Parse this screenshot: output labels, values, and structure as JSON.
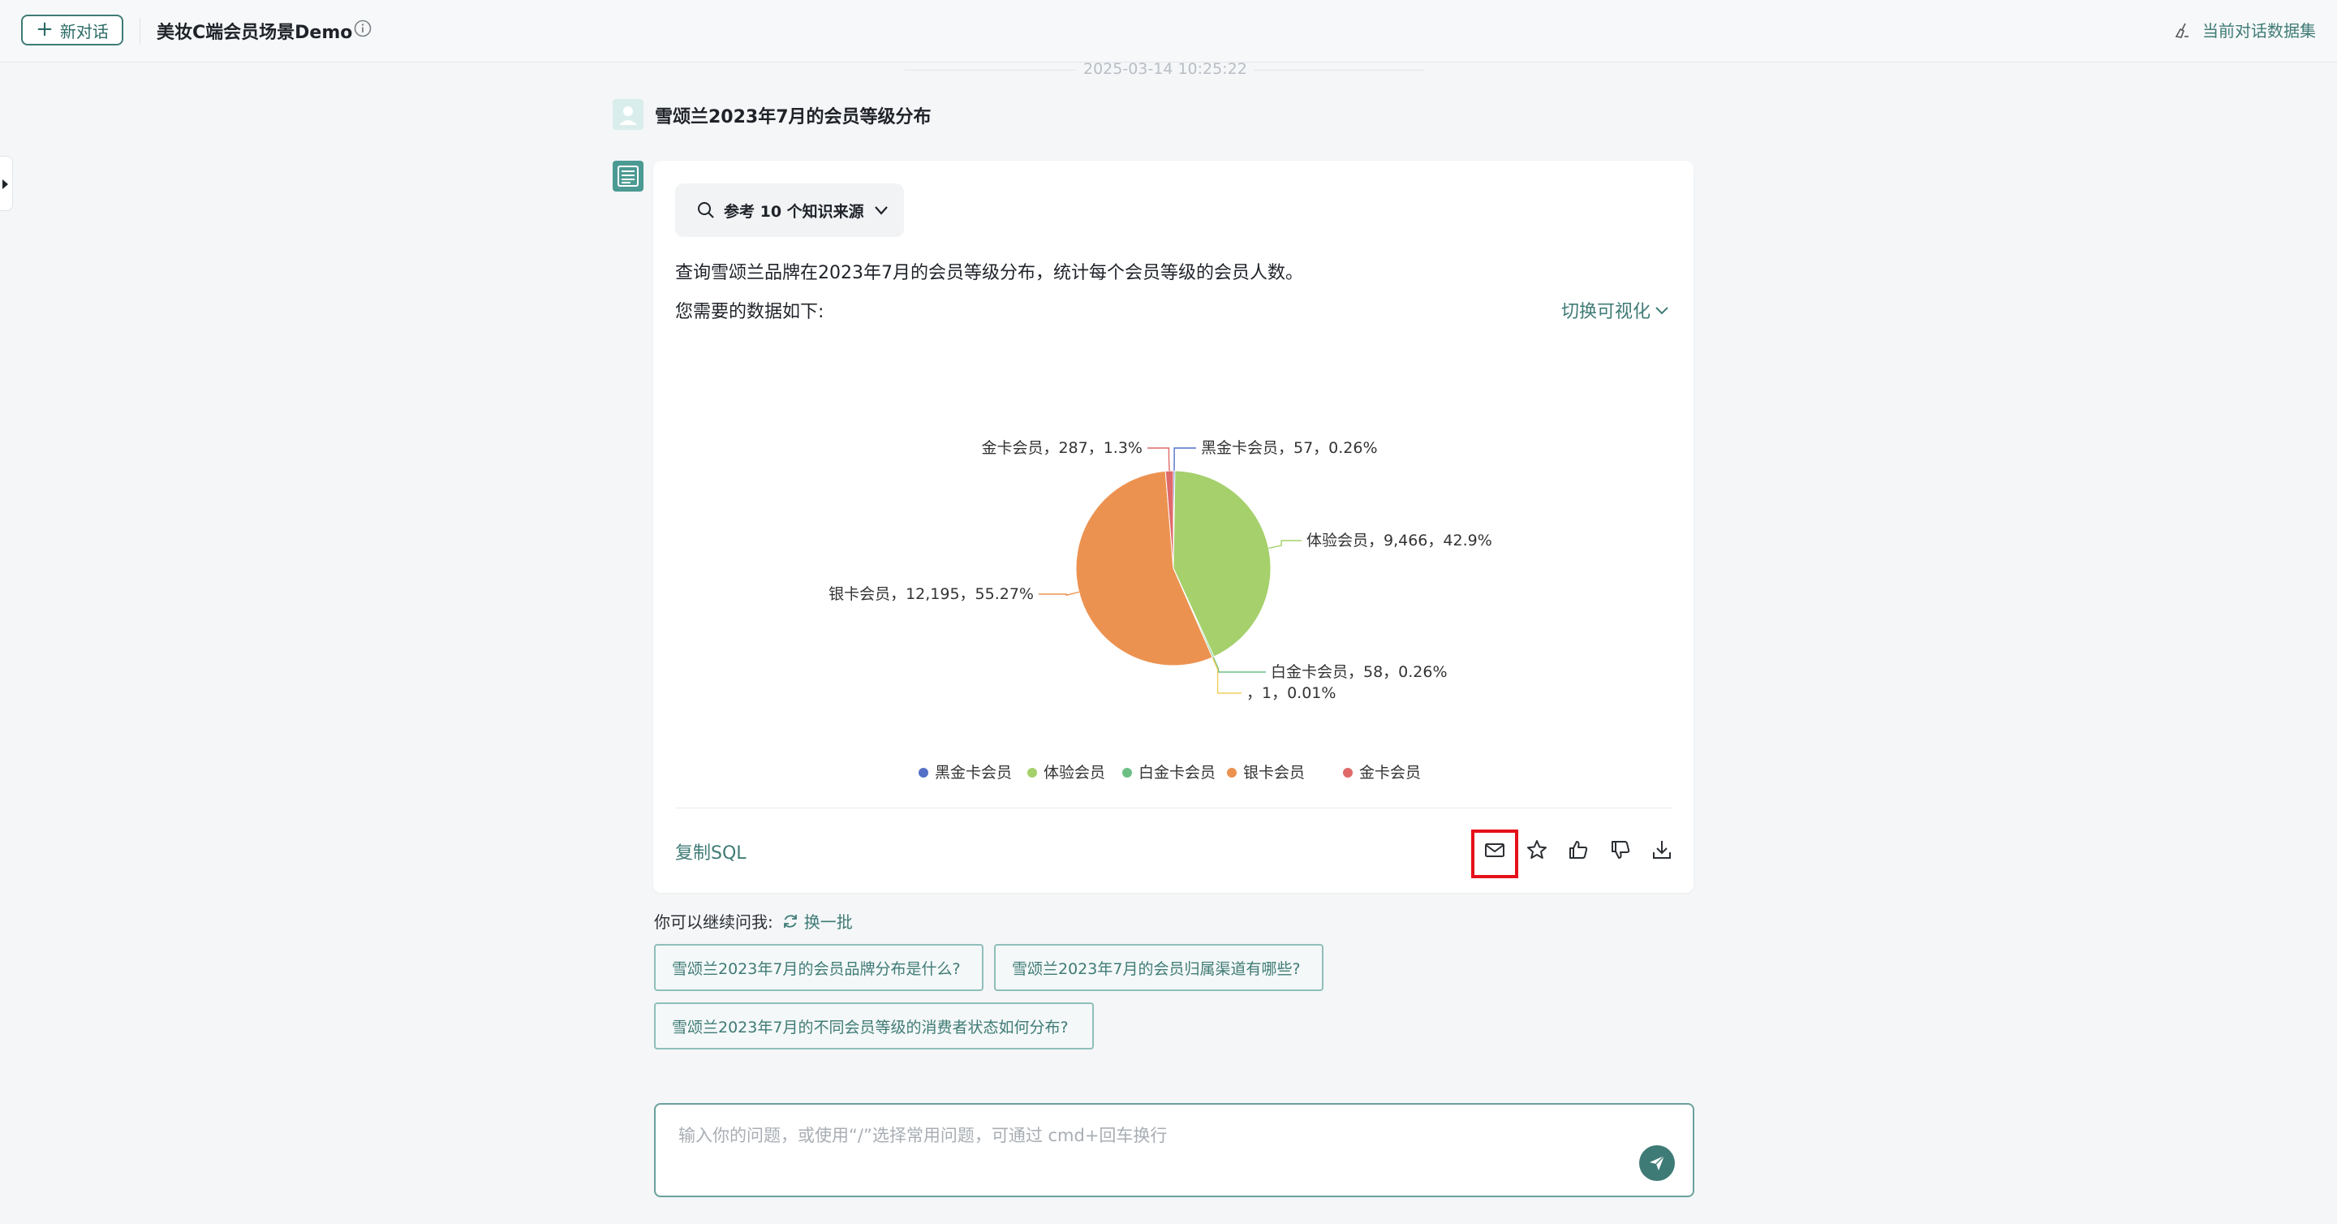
{
  "header": {
    "new_chat_label": "新对话",
    "app_title": "美妆C端会员场景Demo",
    "dataset_label": "当前对话数据集"
  },
  "conversation": {
    "timestamp": "2025-03-14 10:25:22",
    "question": "雪颂兰2023年7月的会员等级分布"
  },
  "answer": {
    "sources_label": "参考 10 个知识来源",
    "text": "查询雪颂兰品牌在2023年7月的会员等级分布，统计每个会员等级的会员人数。",
    "data_intro": "您需要的数据如下:",
    "switch_viz_label": "切换可视化",
    "copy_sql_label": "复制SQL",
    "actions": [
      "mail-icon",
      "star-icon",
      "thumbs-up-icon",
      "thumbs-down-icon",
      "download-icon"
    ]
  },
  "chart_data": {
    "type": "pie",
    "slices": [
      {
        "name": "黑金卡会员",
        "value": 57,
        "percent": "0.26%",
        "color": "#5470c6",
        "label": "黑金卡会员，57，0.26%"
      },
      {
        "name": "体验会员",
        "value": 9466,
        "percent": "42.9%",
        "color": "#a5d06b",
        "label": "体验会员，9,466，42.9%"
      },
      {
        "name": "白金卡会员",
        "value": 58,
        "percent": "0.26%",
        "color": "#6cbf84",
        "label": "白金卡会员，58，0.26%"
      },
      {
        "name": "",
        "value": 1,
        "percent": "0.01%",
        "color": "#f2cf5b",
        "label": "，1，0.01%"
      },
      {
        "name": "银卡会员",
        "value": 12195,
        "percent": "55.27%",
        "color": "#ec9250",
        "label": "银卡会员，12,195，55.27%"
      },
      {
        "name": "金卡会员",
        "value": 287,
        "percent": "1.3%",
        "color": "#e06a6a",
        "label": "金卡会员，287，1.3%"
      }
    ],
    "legend": [
      "黑金卡会员",
      "体验会员",
      "白金卡会员",
      "银卡会员",
      "金卡会员"
    ],
    "legend_colors": [
      "#5470c6",
      "#a5d06b",
      "#6cbf84",
      "#ec9250",
      "#e06a6a"
    ],
    "legend_position": "bottom"
  },
  "followups": {
    "label": "你可以继续问我:",
    "refresh_label": "换一批",
    "suggestions": [
      "雪颂兰2023年7月的会员品牌分布是什么?",
      "雪颂兰2023年7月的会员归属渠道有哪些?",
      "雪颂兰2023年7月的不同会员等级的消费者状态如何分布?"
    ]
  },
  "input": {
    "placeholder": "输入你的问题，或使用“/”选择常用问题，可通过 cmd+回车换行"
  },
  "colors": {
    "accent": "#3f7b76",
    "highlight": "#e5101a"
  }
}
